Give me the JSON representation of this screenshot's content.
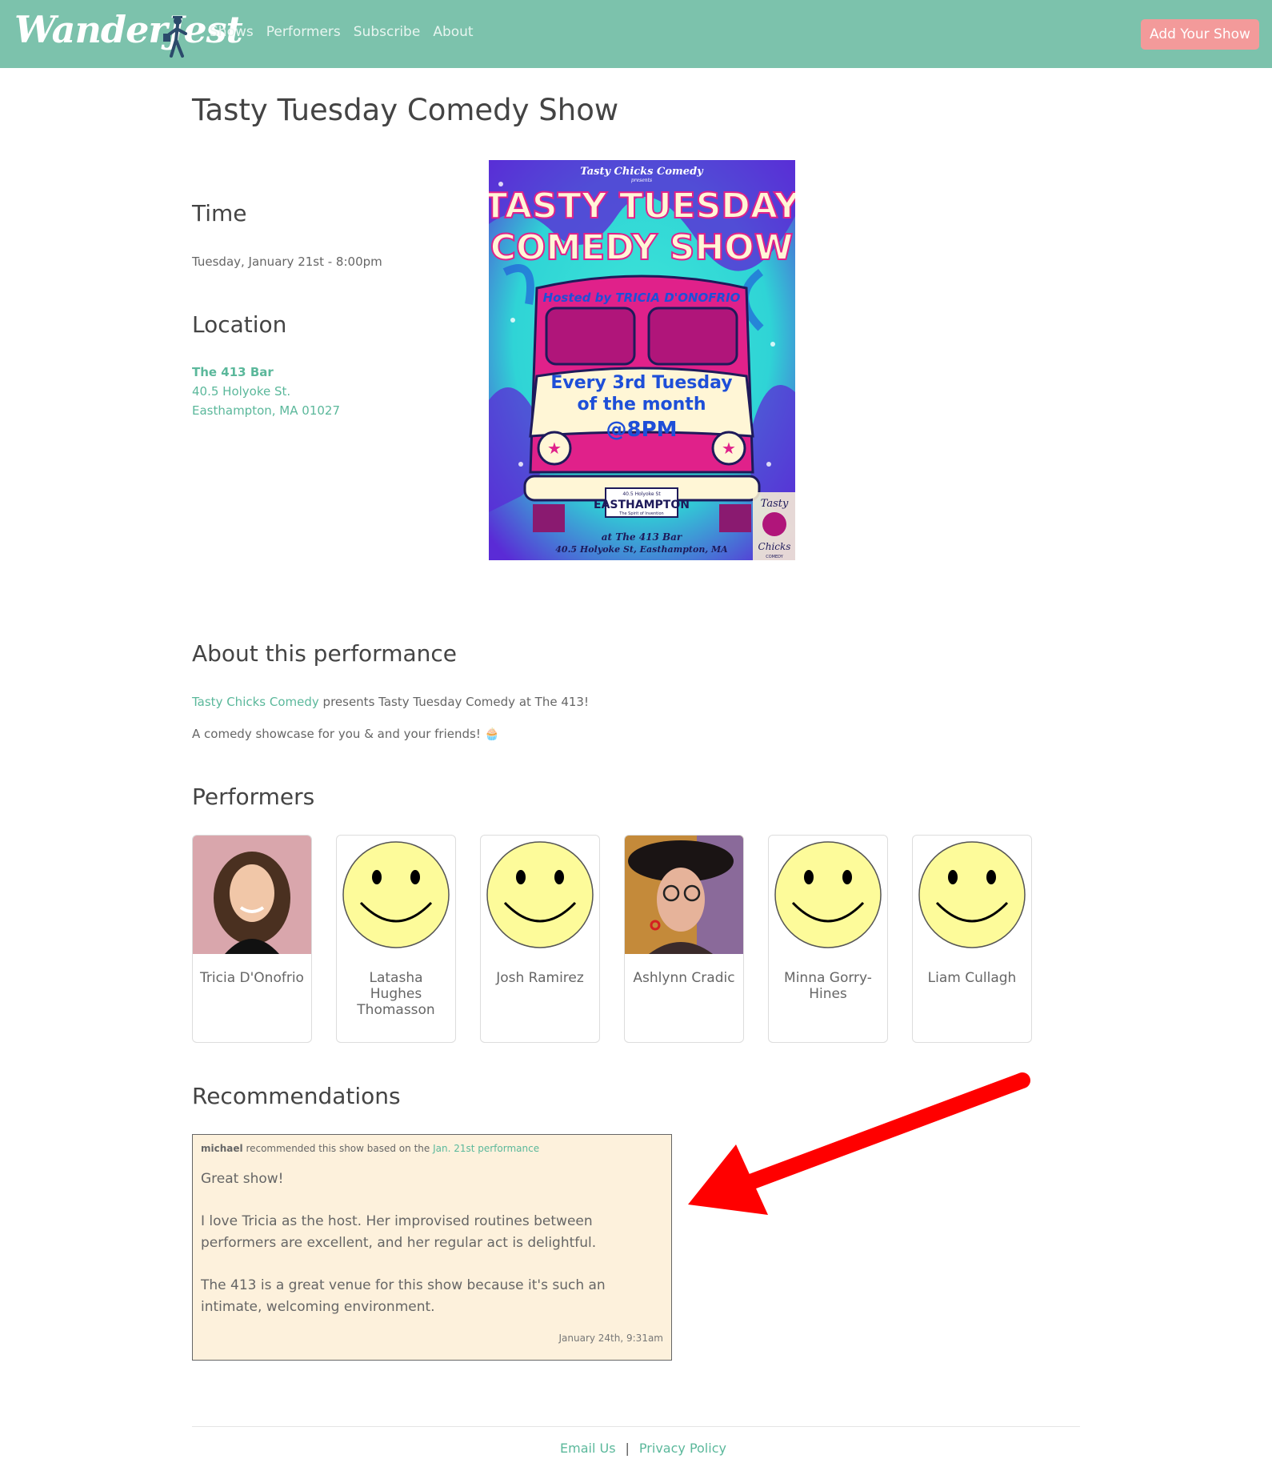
{
  "nav": {
    "brand": "WanderJest",
    "links": [
      "Shows",
      "Performers",
      "Subscribe",
      "About"
    ],
    "add_show": "Add Your Show"
  },
  "show": {
    "title": "Tasty Tuesday Comedy Show",
    "time_heading": "Time",
    "time_value": "Tuesday, January 21st - 8:00pm",
    "location_heading": "Location",
    "venue_name": "The 413 Bar",
    "address_line1": "40.5 Holyoke St.",
    "address_line2": "Easthampton, MA 01027"
  },
  "poster": {
    "presenter": "Tasty Chicks Comedy",
    "presents": "presents",
    "title_line1": "TASTY TUESDAY",
    "title_line2": "COMEDY SHOW",
    "host": "Hosted by TRICIA D'ONOFRIO",
    "schedule_line1": "Every 3rd Tuesday",
    "schedule_line2": "of the month",
    "schedule_line3": "@8PM",
    "plate_top": "40.5 Holyoke St",
    "plate_city": "EASTHAMPTON",
    "plate_bottom": "The Spirit of Invention",
    "venue_line1": "at The 413 Bar",
    "venue_line2": "40.5 Holyoke St, Easthampton, MA",
    "badge_line1": "Tasty",
    "badge_line2": "Chicks",
    "badge_line3": "COMEDY",
    "colors": {
      "pink": "#e0218a",
      "cyan": "#3ee6d8",
      "purple": "#5a2bd6",
      "cream": "#fff6d6",
      "blue": "#1e4fd8"
    }
  },
  "about": {
    "heading": "About this performance",
    "presenter_link": "Tasty Chicks Comedy",
    "line1_rest": " presents Tasty Tuesday Comedy at The 413!",
    "line2": "A comedy showcase for you & and your friends! 🧁"
  },
  "performers": {
    "heading": "Performers",
    "list": [
      {
        "name": "Tricia D'Onofrio",
        "avatar": "photo"
      },
      {
        "name": "Latasha Hughes Thomasson",
        "avatar": "smiley"
      },
      {
        "name": "Josh Ramirez",
        "avatar": "smiley"
      },
      {
        "name": "Ashlynn Cradic",
        "avatar": "photo"
      },
      {
        "name": "Minna Gorry-Hines",
        "avatar": "smiley"
      },
      {
        "name": "Liam Cullagh",
        "avatar": "smiley"
      }
    ]
  },
  "recommendations": {
    "heading": "Recommendations",
    "items": [
      {
        "user": "michael",
        "meta_text": " recommended this show based on the ",
        "performance_link": "Jan. 21st performance",
        "paragraphs": [
          "Great show!",
          "I love Tricia as the host. Her improvised routines between performers are excellent, and her regular act is delightful.",
          "The 413 is a great venue for this show because it's such an intimate, welcoming environment."
        ],
        "date": "January 24th, 9:31am"
      }
    ]
  },
  "footer": {
    "email": "Email Us",
    "separator": "|",
    "privacy": "Privacy Policy"
  },
  "colors": {
    "navbar": "#7cc2ac",
    "accent_teal": "#5bb89b",
    "button_pink": "#f39a9a",
    "rec_background": "#fdf1dc",
    "arrow_red": "#ff0000",
    "smiley_yellow": "#fdfb9a"
  }
}
